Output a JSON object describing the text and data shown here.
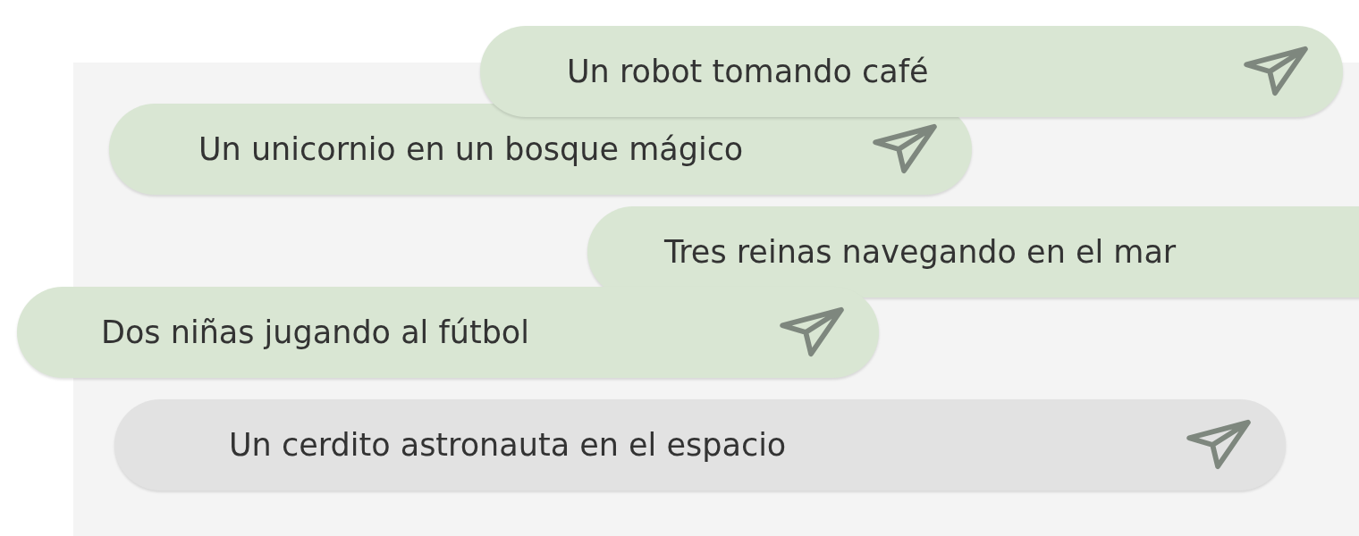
{
  "prompts": [
    {
      "text": "Un robot tomando café",
      "kind": "suggestion",
      "send_icon": true
    },
    {
      "text": "Un unicornio en un bosque mágico",
      "kind": "suggestion",
      "send_icon": true
    },
    {
      "text": "Tres reinas navegando en el mar",
      "kind": "suggestion",
      "send_icon": false
    },
    {
      "text": "Dos niñas jugando al fútbol",
      "kind": "suggestion",
      "send_icon": true
    },
    {
      "text": "Un cerdito astronauta en el espacio",
      "kind": "input",
      "send_icon": true
    }
  ]
}
